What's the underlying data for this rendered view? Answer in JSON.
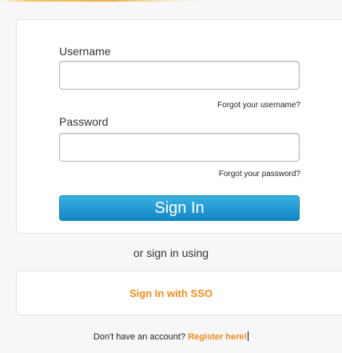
{
  "login": {
    "username_label": "Username",
    "username_value": "",
    "forgot_username": "Forgot your username?",
    "password_label": "Password",
    "password_value": "",
    "forgot_password": "Forgot your password?",
    "signin_button": "Sign In"
  },
  "alt": {
    "or_text": "or sign in using",
    "sso_link": "Sign In with SSO"
  },
  "footer": {
    "prompt": "Don't have an account? ",
    "register_link": "Register here!"
  },
  "colors": {
    "accent_orange": "#f08c1c",
    "button_blue": "#1386c5"
  }
}
